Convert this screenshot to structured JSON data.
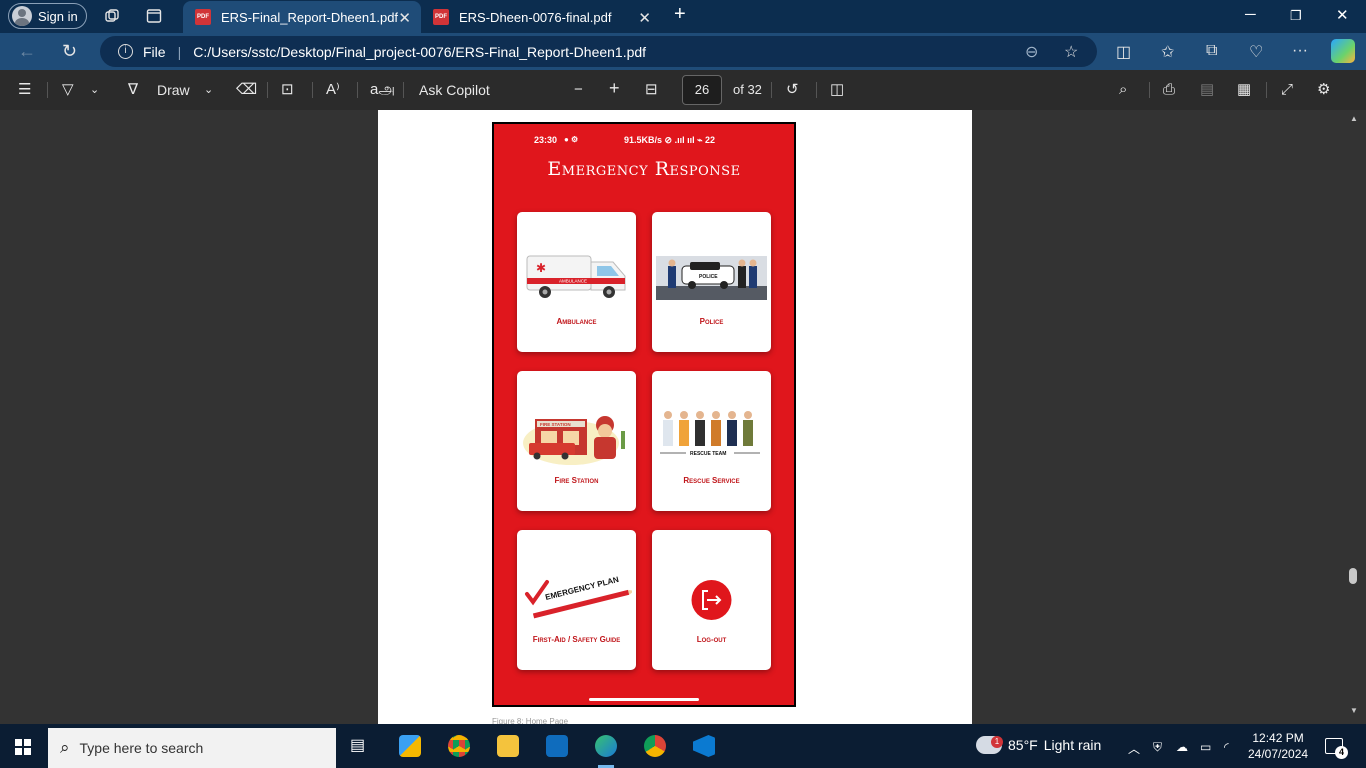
{
  "browser": {
    "signin_label": "Sign in",
    "tabs": [
      {
        "title": "ERS-Final_Report-Dheen1.pdf",
        "pdf_badge": "PDF"
      },
      {
        "title": "ERS-Dheen-0076-final.pdf",
        "pdf_badge": "PDF"
      }
    ],
    "file_label": "File",
    "url": "C:/Users/sstc/Desktop/Final_project-0076/ERS-Final_Report-Dheen1.pdf"
  },
  "pdf_toolbar": {
    "draw_label": "Draw",
    "read_aloud_glyph": "A⁾",
    "translate_glyph": "aஅ",
    "ask_copilot_label": "Ask Copilot",
    "page_current": "26",
    "page_total": "of 32"
  },
  "phone": {
    "status_time": "23:30",
    "status_right": "91.5KB/s ⊘ .ııl ııl ⌁ 22",
    "app_title": "Emergency Response",
    "cards": [
      {
        "label": "Ambulance",
        "art_text": "AMBULANCE"
      },
      {
        "label": "Police",
        "art_text": "POLICE"
      },
      {
        "label": "Fire Station",
        "art_text": "FIRE STATION"
      },
      {
        "label": "Rescue Service",
        "art_text": "RESCUE TEAM"
      },
      {
        "label": "First-Aid / Safety Guide",
        "art_text": "EMERGENCY PLAN"
      },
      {
        "label": "Log-out"
      }
    ],
    "caption": "Figure 8: Home Page"
  },
  "taskbar": {
    "search_placeholder": "Type here to search",
    "weather_temp": "85°F",
    "weather_desc": "Light rain",
    "weather_badge": "1",
    "time": "12:42 PM",
    "date": "24/07/2024",
    "notification_count": "4"
  },
  "colors": {
    "app_red": "#e0161c",
    "label_red": "#c0151a",
    "tab_active": "#1f4c78",
    "titlebar": "#0c2d4f"
  }
}
